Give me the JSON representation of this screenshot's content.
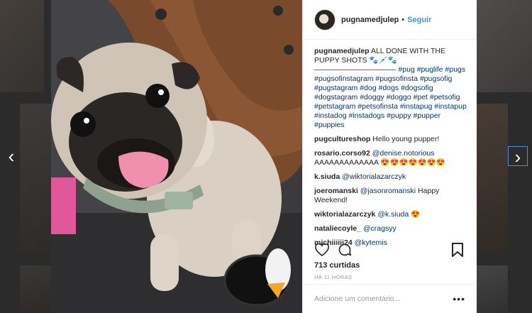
{
  "post": {
    "username": "pugnamedjulep",
    "separator": "•",
    "follow_label": "Seguir",
    "caption_user": "pugnamedjulep",
    "caption_text": "ALL DONE WITH THE PUPPY SHOTS 🐾💉🐾 ——————————— ",
    "caption_hashtags": "#pug #puglife #pugs #pugsofinstagram #pugsofinsta #pugsofig #pugstagram #dog #dogs #dogsofig #dogstagram #doggy #doggo #pet #petsofig #petstagram #petsofinsta #instapug #instapup #instadog #instadogs #puppy #pupper #puppies"
  },
  "comments": [
    {
      "user": "pugcultureshop",
      "mention": "",
      "text": "Hello young pupper!"
    },
    {
      "user": "rosario.corso92",
      "mention": "@denise.notorious",
      "text": " AAAAAAAAAAAAA 😍😍😍😍😍😍😍"
    },
    {
      "user": "k.siuda",
      "mention": "@wiktorialazarczyk",
      "text": ""
    },
    {
      "user": "joeromanski",
      "mention": "@jasonromanski",
      "text": " Happy Weekend!"
    },
    {
      "user": "wiktorialazarczyk",
      "mention": "@k.siuda",
      "text": " 😍"
    },
    {
      "user": "nataliecoyle_",
      "mention": "@cragsyy",
      "text": ""
    },
    {
      "user": "michiiiiii24",
      "mention": "@kytemis",
      "text": ""
    }
  ],
  "stats": {
    "likes": "713 curtidas",
    "time": "HÁ 11 HORAS"
  },
  "composer": {
    "placeholder": "Adicione um comentário..."
  },
  "icons": {
    "like": "heart-icon",
    "comment": "comment-bubble-icon",
    "save": "bookmark-icon",
    "options": "more-options-icon",
    "prev": "chevron-left-icon",
    "next": "chevron-right-icon"
  },
  "colors": {
    "link": "#3897f0",
    "hashtag": "#003569",
    "text": "#262626",
    "muted": "#999999"
  }
}
